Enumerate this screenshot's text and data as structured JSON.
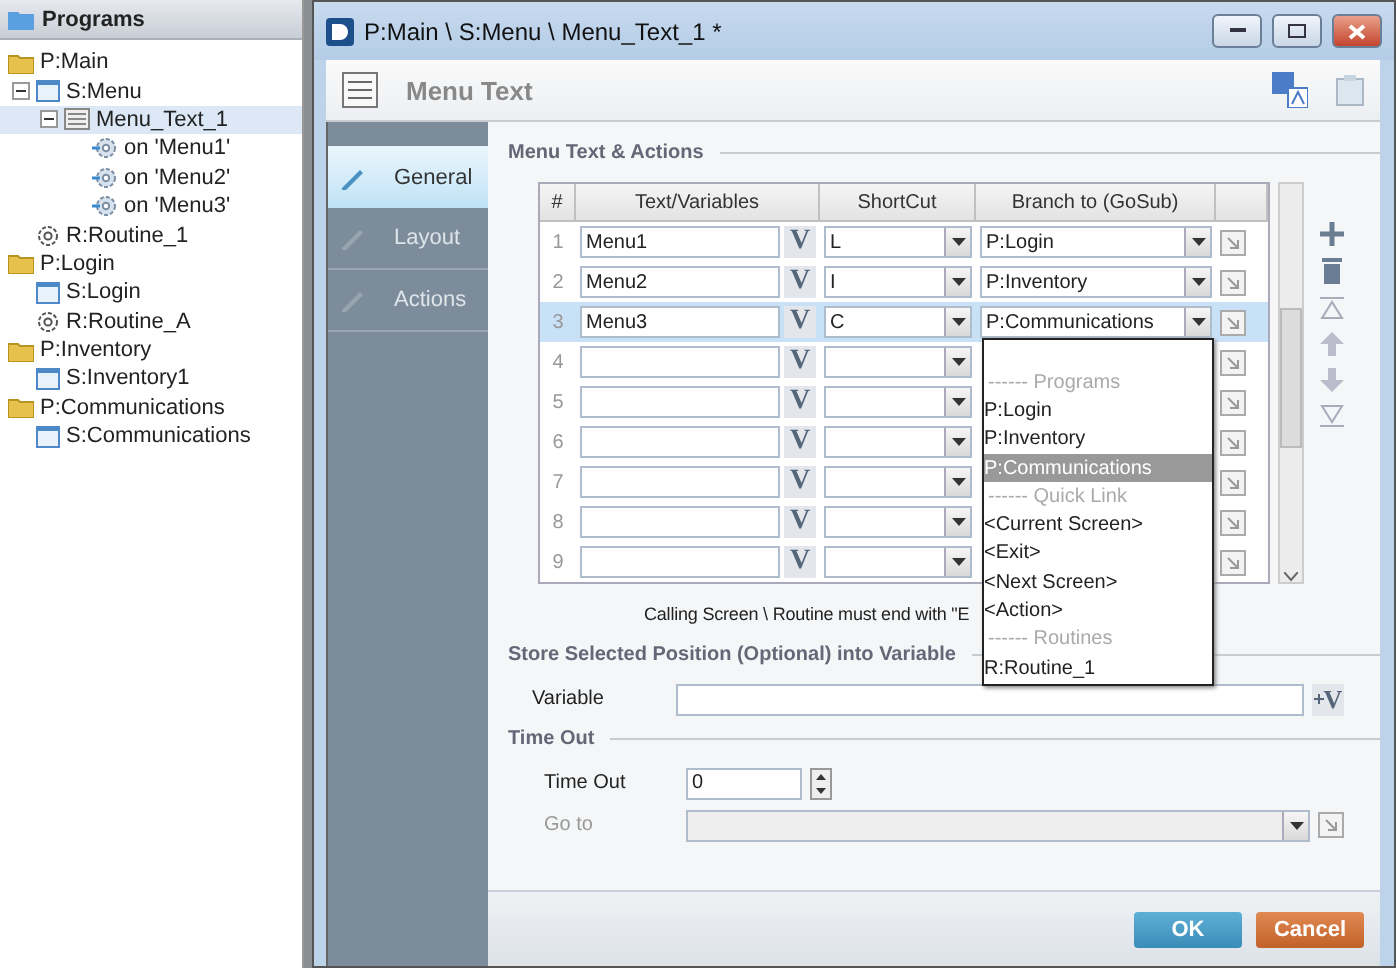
{
  "sidebar": {
    "title": "Programs",
    "tree": [
      {
        "label": "P:Main",
        "kind": "program",
        "selected": false,
        "children": [
          {
            "label": "S:Menu",
            "kind": "screen",
            "expanded": true,
            "selected": false,
            "children": [
              {
                "label": "Menu_Text_1",
                "kind": "menu",
                "expanded": true,
                "selected": true,
                "children": [
                  {
                    "label": "on 'Menu1'",
                    "kind": "action",
                    "selected": false
                  },
                  {
                    "label": "on 'Menu2'",
                    "kind": "action",
                    "selected": false
                  },
                  {
                    "label": "on 'Menu3'",
                    "kind": "action",
                    "selected": false
                  }
                ]
              }
            ]
          },
          {
            "label": "R:Routine_1",
            "kind": "routine",
            "selected": false
          }
        ]
      },
      {
        "label": "P:Login",
        "kind": "program",
        "selected": false,
        "children": [
          {
            "label": "S:Login",
            "kind": "screen",
            "selected": false
          },
          {
            "label": "R:Routine_A",
            "kind": "routine",
            "selected": false
          }
        ]
      },
      {
        "label": "P:Inventory",
        "kind": "program",
        "selected": false,
        "children": [
          {
            "label": "S:Inventory1",
            "kind": "screen",
            "selected": false
          }
        ]
      },
      {
        "label": "P:Communications",
        "kind": "program",
        "selected": false,
        "children": [
          {
            "label": "S:Communications",
            "kind": "screen",
            "selected": false
          }
        ]
      }
    ]
  },
  "window": {
    "title": "P:Main \\ S:Menu \\ Menu_Text_1 *",
    "header": "Menu Text"
  },
  "nav": [
    {
      "label": "General",
      "selected": true
    },
    {
      "label": "Layout",
      "selected": false
    },
    {
      "label": "Actions",
      "selected": false
    }
  ],
  "menu_section": {
    "title": "Menu Text & Actions",
    "columns": [
      "#",
      "Text/Variables",
      "ShortCut",
      "Branch to (GoSub)"
    ],
    "rows": [
      {
        "number": "1",
        "text": "Menu1",
        "var_button": "V",
        "shortcut": "L",
        "branch": "P:Login",
        "selected": false
      },
      {
        "number": "2",
        "text": "Menu2",
        "var_button": "V",
        "shortcut": "I",
        "branch": "P:Inventory",
        "selected": false
      },
      {
        "number": "3",
        "text": "Menu3",
        "var_button": "V",
        "shortcut": "C",
        "branch": "P:Communications",
        "selected": true
      },
      {
        "number": "4",
        "var_button": "V",
        "selected": false
      },
      {
        "number": "5",
        "var_button": "V",
        "selected": false
      },
      {
        "number": "6",
        "var_button": "V",
        "selected": false
      },
      {
        "number": "7",
        "var_button": "V",
        "selected": false
      },
      {
        "number": "8",
        "var_button": "V",
        "selected": false
      },
      {
        "number": "9",
        "var_button": "V",
        "selected": false
      }
    ],
    "dropdown": [
      {
        "label": "------ Programs",
        "kind": "header"
      },
      {
        "label": "P:Login",
        "kind": "option",
        "selected": false
      },
      {
        "label": "P:Inventory",
        "kind": "option",
        "selected": false
      },
      {
        "label": "P:Communications",
        "kind": "option",
        "selected": true
      },
      {
        "label": "------ Quick Link",
        "kind": "header"
      },
      {
        "label": "<Current Screen>",
        "kind": "option",
        "selected": false
      },
      {
        "label": "<Exit>",
        "kind": "option",
        "selected": false
      },
      {
        "label": "<Next Screen>",
        "kind": "option",
        "selected": false
      },
      {
        "label": "<Action>",
        "kind": "option",
        "selected": false
      },
      {
        "label": "------ Routines",
        "kind": "header"
      },
      {
        "label": "R:Routine_1",
        "kind": "option",
        "selected": false
      }
    ],
    "note": "Calling Screen \\ Routine must end with \"E"
  },
  "store_section": {
    "title": "Store Selected Position (Optional) into Variable",
    "variable_label": "Variable",
    "variable_button": "V"
  },
  "timeout_section": {
    "title": "Time Out",
    "timeout_label": "Time Out",
    "timeout_value": "0",
    "goto_label": "Go to",
    "goto_disabled": true
  },
  "buttons": {
    "ok": "OK",
    "cancel": "Cancel"
  }
}
